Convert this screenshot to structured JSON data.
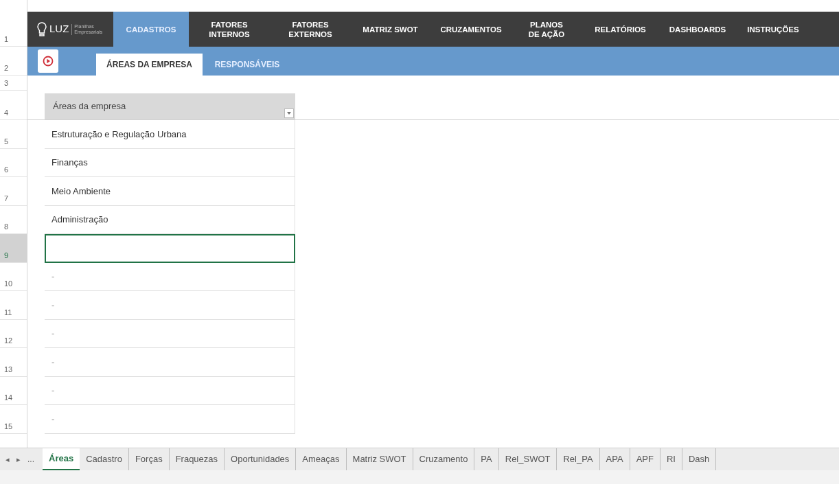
{
  "row_numbers": [
    "1",
    "2",
    "3",
    "4",
    "5",
    "6",
    "7",
    "8",
    "9",
    "10",
    "11",
    "12",
    "13",
    "14",
    "15"
  ],
  "logo": {
    "name": "LUZ",
    "tagline": "Planilhas Empresariais"
  },
  "nav": [
    {
      "label": "CADASTROS",
      "selected": true
    },
    {
      "label": "FATORES INTERNOS",
      "selected": false
    },
    {
      "label": "FATORES EXTERNOS",
      "selected": false
    },
    {
      "label": "MATRIZ SWOT",
      "selected": false
    },
    {
      "label": "CRUZAMENTOS",
      "selected": false
    },
    {
      "label": "PLANOS DE AÇÃO",
      "selected": false
    },
    {
      "label": "RELATÓRIOS",
      "selected": false
    },
    {
      "label": "DASHBOARDS",
      "selected": false
    },
    {
      "label": "INSTRUÇÕES",
      "selected": false
    }
  ],
  "subtabs": [
    {
      "label": "ÁREAS DA EMPRESA",
      "selected": true
    },
    {
      "label": "RESPONSÁVEIS",
      "selected": false
    }
  ],
  "table": {
    "header": "Áreas da empresa",
    "rows": [
      {
        "kind": "value",
        "text": "Estruturação e Regulação Urbana",
        "selected": false
      },
      {
        "kind": "value",
        "text": "Finanças",
        "selected": false
      },
      {
        "kind": "value",
        "text": "Meio Ambiente",
        "selected": false
      },
      {
        "kind": "value",
        "text": "Administração",
        "selected": false
      },
      {
        "kind": "empty",
        "selected": true
      },
      {
        "kind": "dash",
        "text": "-",
        "selected": false
      },
      {
        "kind": "dash",
        "text": "-",
        "selected": false
      },
      {
        "kind": "dash",
        "text": "-",
        "selected": false
      },
      {
        "kind": "dash",
        "text": "-",
        "selected": false
      },
      {
        "kind": "dash",
        "text": "-",
        "selected": false
      },
      {
        "kind": "dash",
        "text": "-",
        "selected": false
      }
    ]
  },
  "sheet_nav": {
    "prev": "◂",
    "next": "▸",
    "more": "..."
  },
  "sheet_tabs": [
    {
      "label": "Áreas",
      "selected": true
    },
    {
      "label": "Cadastro",
      "selected": false
    },
    {
      "label": "Forças",
      "selected": false
    },
    {
      "label": "Fraquezas",
      "selected": false
    },
    {
      "label": "Oportunidades",
      "selected": false
    },
    {
      "label": "Ameaças",
      "selected": false
    },
    {
      "label": "Matriz SWOT",
      "selected": false
    },
    {
      "label": "Cruzamento",
      "selected": false
    },
    {
      "label": "PA",
      "selected": false
    },
    {
      "label": "Rel_SWOT",
      "selected": false
    },
    {
      "label": "Rel_PA",
      "selected": false
    },
    {
      "label": "APA",
      "selected": false
    },
    {
      "label": "APF",
      "selected": false
    },
    {
      "label": "RI",
      "selected": false
    },
    {
      "label": "Dash",
      "selected": false
    }
  ]
}
